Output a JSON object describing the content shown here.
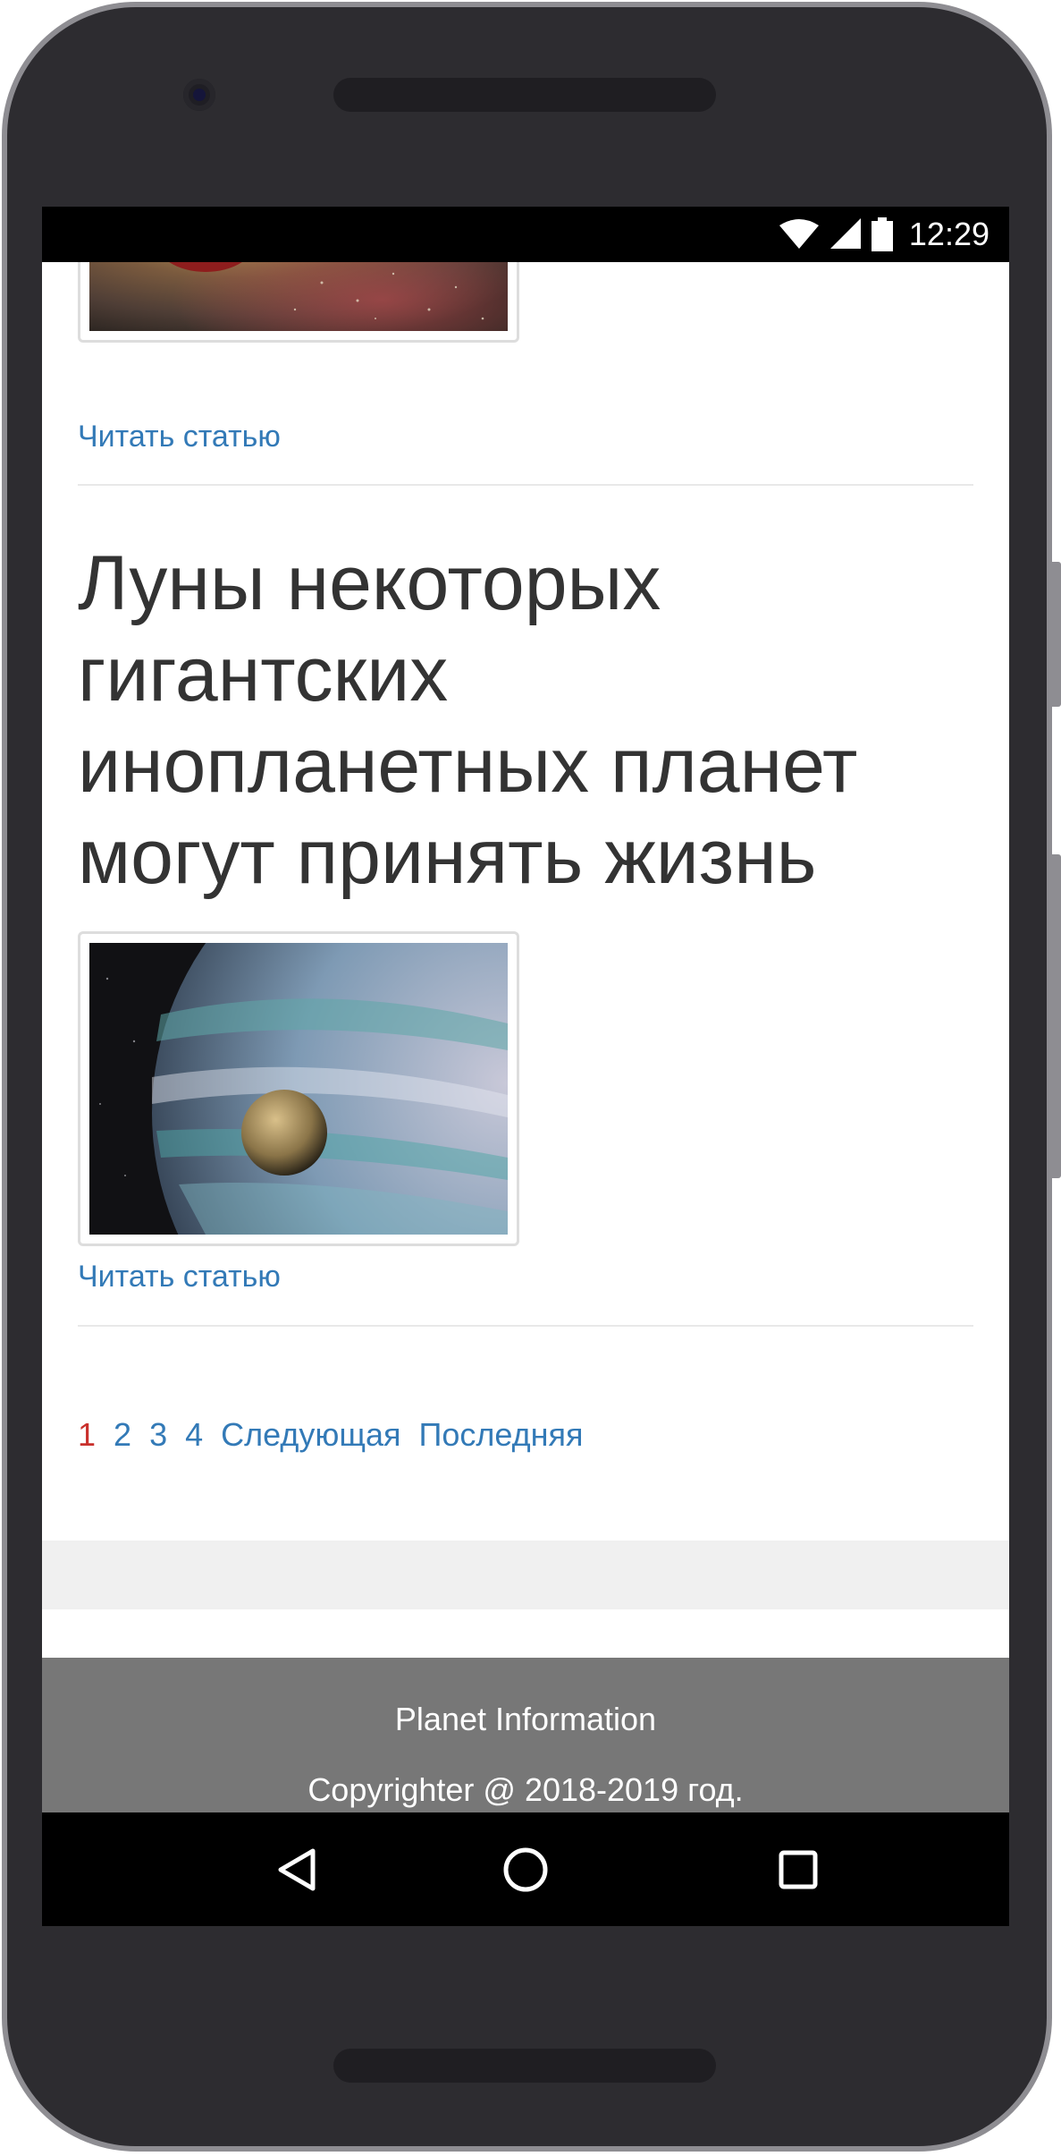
{
  "status_bar": {
    "time": "12:29",
    "icons": [
      "wifi-icon",
      "cell-signal-icon",
      "battery-icon"
    ]
  },
  "articles": [
    {
      "read_more_label": "Читать статью",
      "image": "nebula-red-planet-thumbnail"
    },
    {
      "title": "Луны некоторых гигантских инопланетных планет могут принять жизнь",
      "read_more_label": "Читать статью",
      "image": "gas-giant-with-moon-thumbnail"
    }
  ],
  "pagination": {
    "pages": [
      "1",
      "2",
      "3",
      "4"
    ],
    "current_page": "1",
    "next_label": "Следующая",
    "last_label": "Последняя"
  },
  "footer": {
    "site_name": "Planet Information",
    "copyright": "Copyrighter @ 2018-2019 год."
  },
  "navigation": {
    "buttons": [
      "back-icon",
      "home-icon",
      "recents-icon"
    ]
  },
  "colors": {
    "link": "#337ab7",
    "current_page": "#c9302c",
    "footer_bg": "#777777",
    "title_text": "#333333"
  }
}
